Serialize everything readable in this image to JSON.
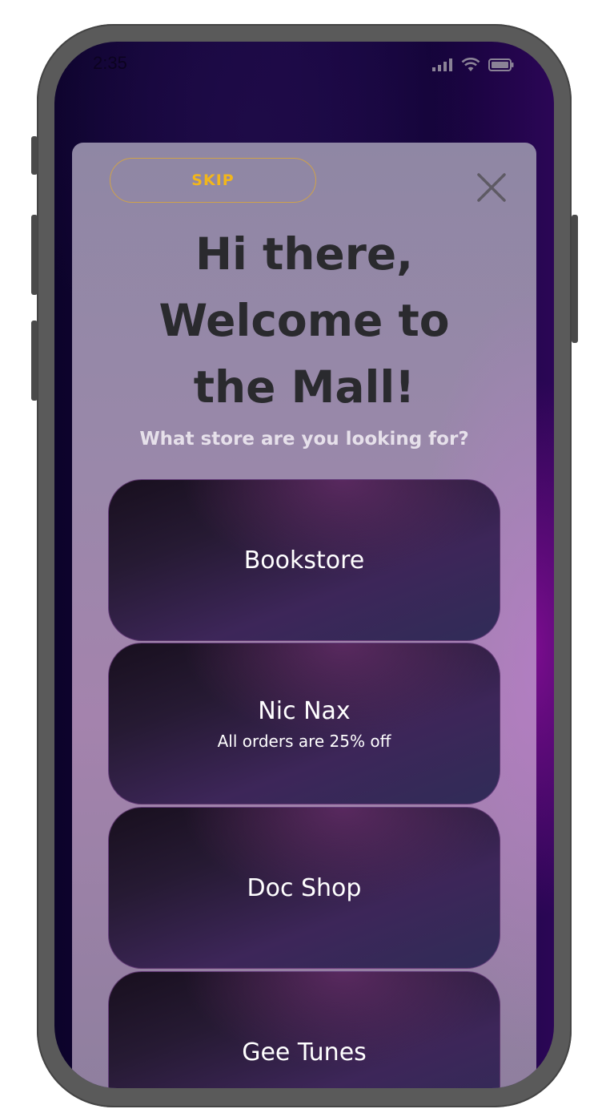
{
  "status_bar": {
    "time": "2:35",
    "icons": [
      "signal-icon",
      "wifi-icon",
      "battery-icon"
    ]
  },
  "modal": {
    "skip_label": "SKIP",
    "close_icon": "close-icon",
    "headline": [
      "Hi there,",
      "Welcome to",
      "the Mall!"
    ],
    "subtitle": "What store are you looking for?",
    "stores": [
      {
        "name": "Bookstore",
        "promo": ""
      },
      {
        "name": "Nic Nax",
        "promo": "All orders are 25% off"
      },
      {
        "name": "Doc Shop",
        "promo": ""
      },
      {
        "name": "Gee Tunes",
        "promo": ""
      }
    ]
  },
  "colors": {
    "accent": "#f2b61b",
    "headline": "#2a2a2e",
    "card_text": "#ffffff"
  }
}
